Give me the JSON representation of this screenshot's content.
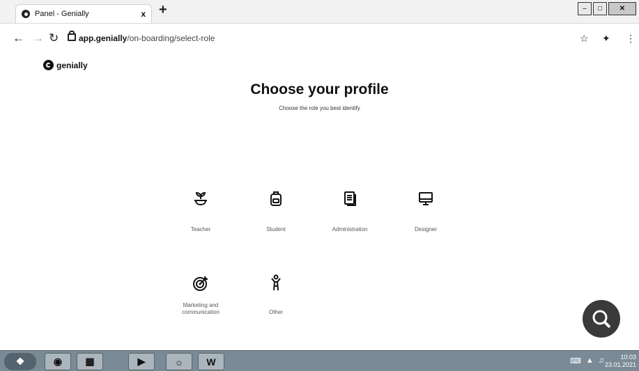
{
  "browser": {
    "tab_title": "Panel - Genially",
    "tab_close": "x",
    "new_tab": "+",
    "url_host": "app.genially",
    "url_path": "/on-boarding/select-role"
  },
  "page": {
    "logo_text": "genially",
    "heading": "Choose your profile",
    "subheading": "Choose the role you best identify",
    "roles": [
      {
        "label": "Teacher",
        "icon": "plant-icon"
      },
      {
        "label": "Student",
        "icon": "backpack-icon"
      },
      {
        "label": "Administration",
        "icon": "document-icon"
      },
      {
        "label": "Designer",
        "icon": "monitor-icon"
      },
      {
        "label": "Marketing and communication",
        "icon": "target-icon"
      },
      {
        "label": "Other",
        "icon": "person-icon"
      }
    ]
  },
  "taskbar": {
    "word_label": "W",
    "time": "10:03",
    "date": "23.01.2021"
  }
}
